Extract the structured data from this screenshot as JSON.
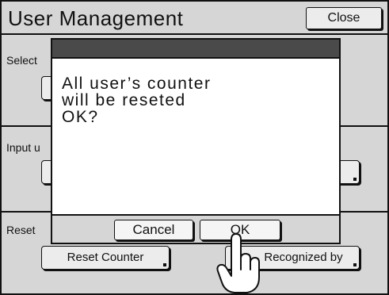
{
  "title_bar": {
    "title": "User Management",
    "close_label": "Close"
  },
  "sections": [
    {
      "label": "Select"
    },
    {
      "label": "Input u"
    },
    {
      "label": "Reset",
      "buttons": [
        "Reset Counter",
        "Recognized by"
      ]
    }
  ],
  "dialog": {
    "message_lines": [
      "All user’s counter",
      "will be reseted",
      "OK?"
    ],
    "cancel_label": "Cancel",
    "ok_label": "OK"
  }
}
